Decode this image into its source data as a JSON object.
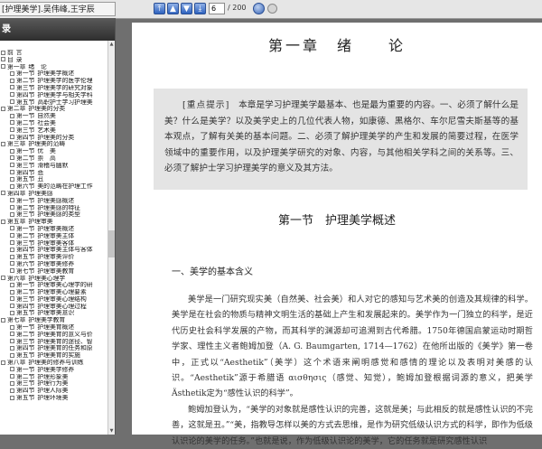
{
  "toolbar": {
    "tab_title": "[护理美学].吴伟峰,王宇辰",
    "page_current": "6",
    "page_total": "/ 200"
  },
  "sidebar": {
    "header": "录",
    "toc": [
      {
        "level": 0,
        "no": "前",
        "title": "言"
      },
      {
        "level": 0,
        "no": "目",
        "title": "录"
      },
      {
        "level": 0,
        "no": "第一章",
        "title": "绪　论"
      },
      {
        "level": 1,
        "no": "第一节",
        "title": "护理美学概述"
      },
      {
        "level": 1,
        "no": "第二节",
        "title": "护理美学的医学伦理"
      },
      {
        "level": 1,
        "no": "第三节",
        "title": "护理美学的研究对象"
      },
      {
        "level": 1,
        "no": "第四节",
        "title": "护理美学与相关学科"
      },
      {
        "level": 1,
        "no": "第五节",
        "title": "高职护士学习护理美"
      },
      {
        "level": 0,
        "no": "第二章",
        "title": "护理美的分类"
      },
      {
        "level": 1,
        "no": "第一节",
        "title": "自然美"
      },
      {
        "level": 1,
        "no": "第二节",
        "title": "社会美"
      },
      {
        "level": 1,
        "no": "第三节",
        "title": "艺术美"
      },
      {
        "level": 1,
        "no": "第四节",
        "title": "护理美的分类"
      },
      {
        "level": 0,
        "no": "第三章",
        "title": "护理美的范畴"
      },
      {
        "level": 1,
        "no": "第一节",
        "title": "优　美"
      },
      {
        "level": 1,
        "no": "第二节",
        "title": "崇　高"
      },
      {
        "level": 1,
        "no": "第三节",
        "title": "滑稽与幽默"
      },
      {
        "level": 1,
        "no": "第四节",
        "title": "悲"
      },
      {
        "level": 1,
        "no": "第五节",
        "title": "丑"
      },
      {
        "level": 1,
        "no": "第六节",
        "title": "美的范畴在护理工作"
      },
      {
        "level": 0,
        "no": "第四章",
        "title": "护理美感"
      },
      {
        "level": 1,
        "no": "第一节",
        "title": "护理美感概述"
      },
      {
        "level": 1,
        "no": "第二节",
        "title": "护理美感的特征"
      },
      {
        "level": 1,
        "no": "第三节",
        "title": "护理美感的类型"
      },
      {
        "level": 0,
        "no": "第五章",
        "title": "护理审美"
      },
      {
        "level": 1,
        "no": "第一节",
        "title": "护理审美概述"
      },
      {
        "level": 1,
        "no": "第二节",
        "title": "护理审美主体"
      },
      {
        "level": 1,
        "no": "第三节",
        "title": "护理审美客体"
      },
      {
        "level": 1,
        "no": "第四节",
        "title": "护理审美主体与客体"
      },
      {
        "level": 1,
        "no": "第五节",
        "title": "护理审美评价"
      },
      {
        "level": 1,
        "no": "第六节",
        "title": "护理审美修养"
      },
      {
        "level": 1,
        "no": "第七节",
        "title": "护理审美教育"
      },
      {
        "level": 0,
        "no": "第六章",
        "title": "护理美心理学"
      },
      {
        "level": 1,
        "no": "第一节",
        "title": "护理审美心理学的研"
      },
      {
        "level": 1,
        "no": "第二节",
        "title": "护理审美心理要素"
      },
      {
        "level": 1,
        "no": "第三节",
        "title": "护理审美心理结构"
      },
      {
        "level": 1,
        "no": "第四节",
        "title": "护理审美心理过程"
      },
      {
        "level": 1,
        "no": "第五节",
        "title": "护理审美意识"
      },
      {
        "level": 0,
        "no": "第七章",
        "title": "护理美学教育"
      },
      {
        "level": 1,
        "no": "第一节",
        "title": "护理美育概述"
      },
      {
        "level": 1,
        "no": "第二节",
        "title": "护理美育的意义与价"
      },
      {
        "level": 1,
        "no": "第三节",
        "title": "护理美育的途径、智"
      },
      {
        "level": 1,
        "no": "第四节",
        "title": "护理美育的任务和原"
      },
      {
        "level": 1,
        "no": "第五节",
        "title": "护理美育的实施"
      },
      {
        "level": 0,
        "no": "第八章",
        "title": "护理美的修养与训练"
      },
      {
        "level": 1,
        "no": "第一节",
        "title": "护理美学修养"
      },
      {
        "level": 1,
        "no": "第二节",
        "title": "护理形象美"
      },
      {
        "level": 1,
        "no": "第三节",
        "title": "护理行为美"
      },
      {
        "level": 1,
        "no": "第四节",
        "title": "护理人际美"
      },
      {
        "level": 1,
        "no": "第五节",
        "title": "护理环境美"
      }
    ]
  },
  "page": {
    "chapter_title": "第一章　绪　　论",
    "keypoints_label": "[重点提示]",
    "keypoints_text": "本章是学习护理美学最基本、也是最为重要的内容。一、必须了解什么是美？什么是美学？以及美学史上的几位代表人物，如康德、黑格尔、车尔尼雪夫斯基等的基本观点，了解有关美的基本问题。二、必须了解护理美学的产生和发展的简要过程，在医学领域中的重要作用，以及护理美学研究的对象、内容，与其他相关学科之间的关系等。三、必须了解护士学习护理美学的意义及其方法。",
    "section_title": "第一节　护理美学概述",
    "sub_heading": "一、美学的基本含义",
    "para1": "美学是一门研究现实美（自然美、社会美）和人对它的感知与艺术美的创造及其规律的科学。美学是在社会的物质与精神文明生活的基础上产生和发展起来的。美学作为一门独立的科学，是近代历史社会科学发展的产物，而其科学的渊源却可追溯到古代希腊。1750年德国启蒙运动时期哲学家、理性主义者鲍姆加登（A. G. Baumgarten, 1714—1762）在他所出版的《美学》第一卷中，正式以“Aesthetik”（美学）这个术语来阐明感觉和感情的理论以及表明对美感的认识。“Aesthetik”源于希腊语 αισθησις（感觉、知觉），鲍姆加登根据词源的意义，把美学Ästhetik定为“感性认识的科学”。",
    "para2": "鲍姆加登认为，“美学的对象就是感性认识的完善，这就是美；与此相反的就是感性认识的不完善，这就是丑。”“美，指教导怎样以美的方式去思维，是作为研究低级认识方式的科学，即作为低级认识论的美学的任务。”也就是说，作为低级认识论的美学，它的任务就是研究感性认识"
  }
}
